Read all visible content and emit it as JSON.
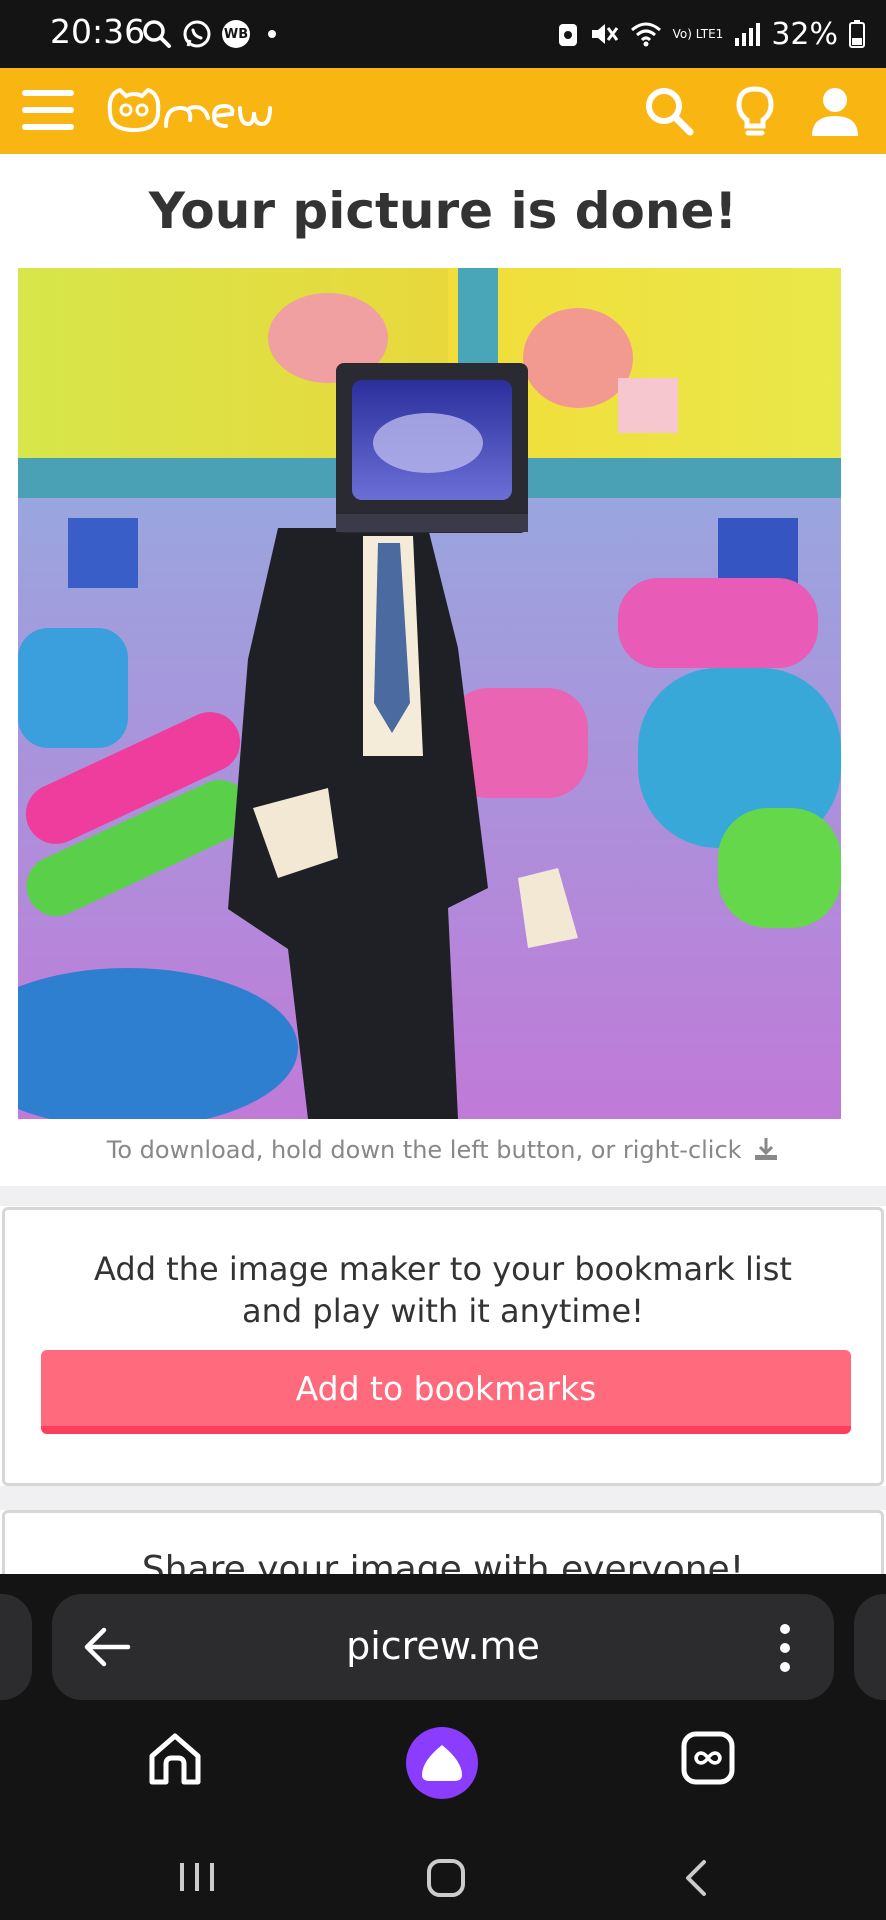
{
  "status_bar": {
    "time": "20:36",
    "battery": "32%",
    "notification_badge": "WB",
    "network_label": "Vo) LTE1"
  },
  "header": {
    "logo_text": "Picrew",
    "icons": [
      "menu-icon",
      "search-icon",
      "lightbulb-icon",
      "user-icon"
    ],
    "accent_color": "#f9b512"
  },
  "main": {
    "title": "Your picture is done!",
    "download_note": "To download, hold down the left button, or right-click"
  },
  "bookmark_card": {
    "message_line1": "Add the image maker to your bookmark list",
    "message_line2": "and play with it anytime!",
    "button_label": "Add to bookmarks",
    "button_color": "#ff6a7c"
  },
  "share_card": {
    "title": "Share your image with everyone!"
  },
  "browser": {
    "url": "picrew.me",
    "bottom_icons": [
      "home-icon",
      "alice-assistant-icon",
      "tabs-icon"
    ]
  }
}
